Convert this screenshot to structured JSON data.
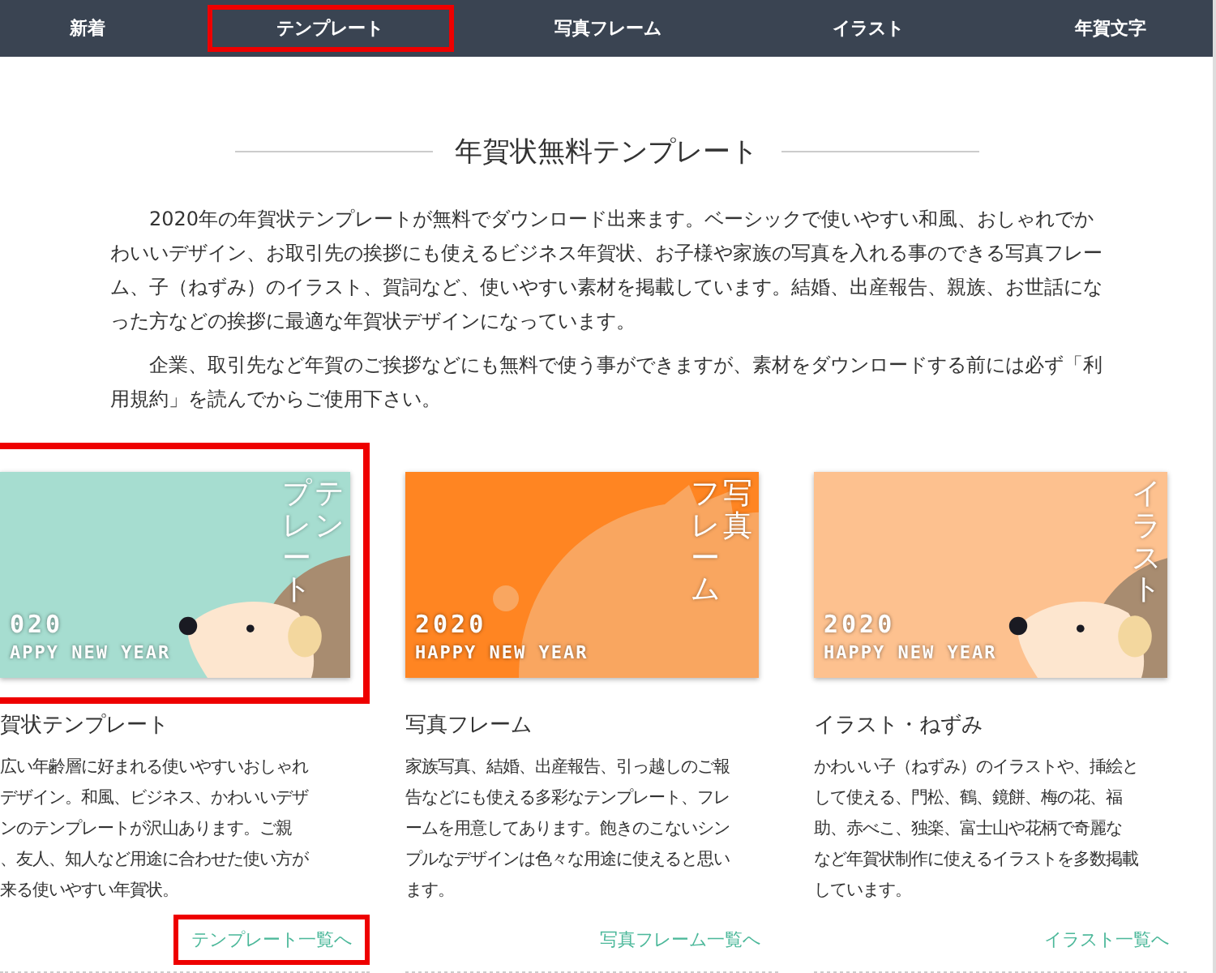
{
  "nav": [
    {
      "label": "新着",
      "highlighted": false
    },
    {
      "label": "テンプレート",
      "highlighted": true
    },
    {
      "label": "写真フレーム",
      "highlighted": false
    },
    {
      "label": "イラスト",
      "highlighted": false
    },
    {
      "label": "年賀文字",
      "highlighted": false
    }
  ],
  "heading": "年賀状無料テンプレート",
  "paragraphs": [
    "2020年の年賀状テンプレートが無料でダウンロード出来ます。ベーシックで使いやすい和風、おしゃれでかわいいデザイン、お取引先の挨拶にも使えるビジネス年賀状、お子様や家族の写真を入れる事のできる写真フレーム、子（ねずみ）のイラスト、賀詞など、使いやすい素材を掲載しています。結婚、出産報告、親族、お世話になった方などの挨拶に最適な年賀状デザインになっています。",
    "企業、取引先など年賀のご挨拶などにも無料で使う事ができますが、素材をダウンロードする前には必ず「利用規約」を読んでからご使用下さい。"
  ],
  "cards": [
    {
      "kind": "hedgehog",
      "highlighted": true,
      "image_columns": [
        "プレート",
        "テン"
      ],
      "image_year": "020",
      "image_greeting": "APPY NEW YEAR",
      "title": "賀状テンプレート",
      "lines": [
        "広い年齢層に好まれる使いやすいおしゃれ",
        "デザイン。和風、ビジネス、かわいいデザ",
        "ンのテンプレートが沢山あります。ご親",
        "、友人、知人など用途に合わせた使い方が",
        "来る使いやすい年賀状。"
      ],
      "link": {
        "label": "テンプレート一覧へ",
        "highlighted": true
      }
    },
    {
      "kind": "silhouette",
      "highlighted": false,
      "image_columns": [
        "フレーム",
        "写真"
      ],
      "image_year": "2020",
      "image_greeting": "HAPPY NEW YEAR",
      "title": "写真フレーム",
      "lines": [
        "家族写真、結婚、出産報告、引っ越しのご報",
        "告などにも使える多彩なテンプレート、フレ",
        "ームを用意してあります。飽きのこないシン",
        "プルなデザインは色々な用途に使えると思い",
        "ます。"
      ],
      "link": {
        "label": "写真フレーム一覧へ",
        "highlighted": false
      }
    },
    {
      "kind": "hedgehog",
      "highlighted": false,
      "image_columns": [
        "イラスト"
      ],
      "image_year": "2020",
      "image_greeting": "HAPPY NEW YEAR",
      "title": "イラスト・ねずみ",
      "lines": [
        "かわいい子（ねずみ）のイラストや、挿絵と",
        "して使える、門松、鶴、鏡餅、梅の花、福",
        "助、赤べこ、独楽、富士山や花柄で奇麗な",
        "など年賀状制作に使えるイラストを多数掲載",
        "しています。"
      ],
      "link": {
        "label": "イラスト一覧へ",
        "highlighted": false
      }
    }
  ]
}
